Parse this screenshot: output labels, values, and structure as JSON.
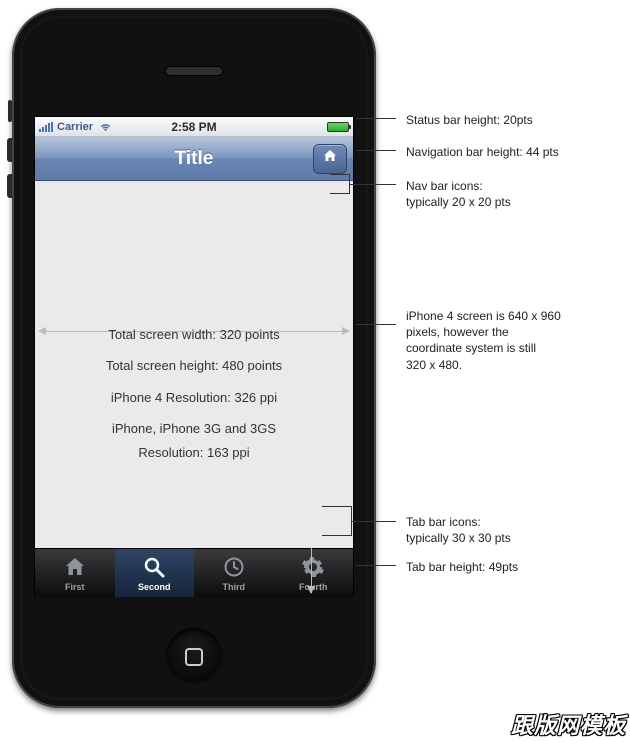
{
  "status_bar": {
    "carrier": "Carrier",
    "time": "2:58 PM"
  },
  "nav_bar": {
    "title": "Title"
  },
  "screen_text": {
    "width_label": "Total screen width: 320 points",
    "height_label": "Total screen height: 480 points",
    "res_iphone4": "iPhone 4 Resolution: 326 ppi",
    "res_old_line1": "iPhone, iPhone 3G and 3GS",
    "res_old_line2": "Resolution: 163 ppi"
  },
  "tabs": [
    {
      "label": "First"
    },
    {
      "label": "Second"
    },
    {
      "label": "Third"
    },
    {
      "label": "Fourth"
    }
  ],
  "annotations": {
    "status_bar_height": "Status bar height: 20pts",
    "nav_bar_height": "Navigation bar height: 44 pts",
    "nav_icons_line1": "Nav bar icons:",
    "nav_icons_line2": "typically 20 x 20 pts",
    "screen_res_line1": "iPhone 4 screen is 640 x 960",
    "screen_res_line2": "pixels, however the",
    "screen_res_line3": "coordinate system is still",
    "screen_res_line4": "320 x 480.",
    "tab_icons_line1": "Tab bar icons:",
    "tab_icons_line2": "typically 30 x 30 pts",
    "tab_bar_height": "Tab bar height: 49pts"
  },
  "watermark": "跟版网模板"
}
